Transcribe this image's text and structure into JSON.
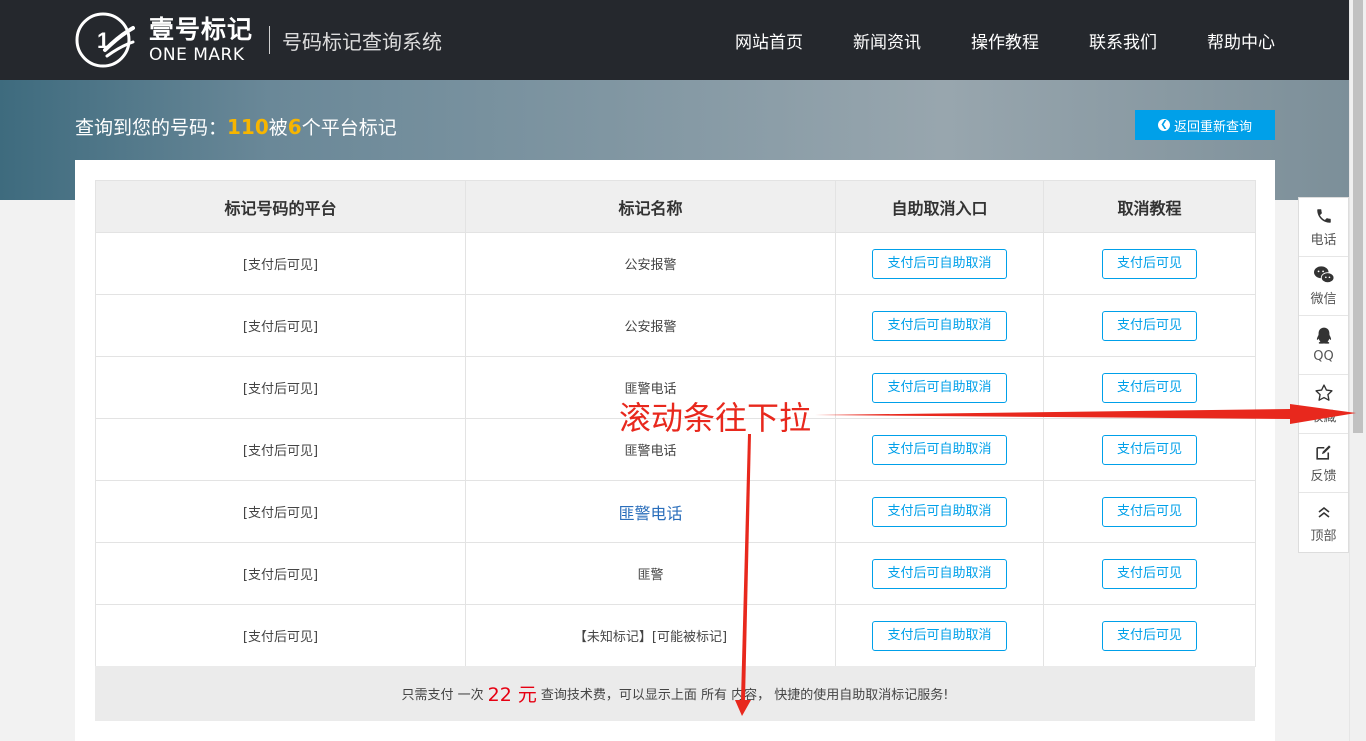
{
  "header": {
    "logo_cn": "壹号标记",
    "logo_en": "ONE MARK",
    "subtitle": "号码标记查询系统",
    "nav": [
      "网站首页",
      "新闻资讯",
      "操作教程",
      "联系我们",
      "帮助中心"
    ]
  },
  "banner": {
    "prefix": "查询到您的号码：",
    "number": "110",
    "mid": "被",
    "count": "6",
    "suffix": "个平台标记",
    "back_button": "返回重新查询"
  },
  "table": {
    "headers": [
      "标记号码的平台",
      "标记名称",
      "自助取消入口",
      "取消教程"
    ],
    "rows": [
      {
        "platform": "[支付后可见]",
        "name": "公安报警",
        "cancel": "支付后可自助取消",
        "tutorial": "支付后可见"
      },
      {
        "platform": "[支付后可见]",
        "name": "公安报警",
        "cancel": "支付后可自助取消",
        "tutorial": "支付后可见"
      },
      {
        "platform": "[支付后可见]",
        "name": "匪警电话",
        "cancel": "支付后可自助取消",
        "tutorial": "支付后可见"
      },
      {
        "platform": "[支付后可见]",
        "name": "匪警电话",
        "cancel": "支付后可自助取消",
        "tutorial": "支付后可见"
      },
      {
        "platform": "[支付后可见]",
        "name": "匪警电话",
        "cancel": "支付后可自助取消",
        "tutorial": "支付后可见"
      },
      {
        "platform": "[支付后可见]",
        "name": "匪警",
        "cancel": "支付后可自助取消",
        "tutorial": "支付后可见"
      },
      {
        "platform": "[支付后可见]",
        "name": "【未知标记】[可能被标记]",
        "cancel": "支付后可自助取消",
        "tutorial": "支付后可见"
      }
    ],
    "footer_prefix": "只需支付 一次",
    "footer_price": "22 元",
    "footer_suffix": "查询技术费，可以显示上面 所有 内容， 快捷的使用自助取消标记服务!"
  },
  "sidebar": {
    "items": [
      {
        "label": "电话",
        "icon": "phone-icon"
      },
      {
        "label": "微信",
        "icon": "wechat-icon"
      },
      {
        "label": "QQ",
        "icon": "qq-icon"
      },
      {
        "label": "收藏",
        "icon": "star-icon"
      },
      {
        "label": "反馈",
        "icon": "edit-icon"
      },
      {
        "label": "顶部",
        "icon": "double-up-icon"
      }
    ]
  },
  "annotation": {
    "text": "滚动条往下拉",
    "color": "#e8281d"
  },
  "colors": {
    "header_bg": "#25282d",
    "accent": "#00a0e9",
    "highlight": "#f7b500",
    "price": "#e60012"
  }
}
